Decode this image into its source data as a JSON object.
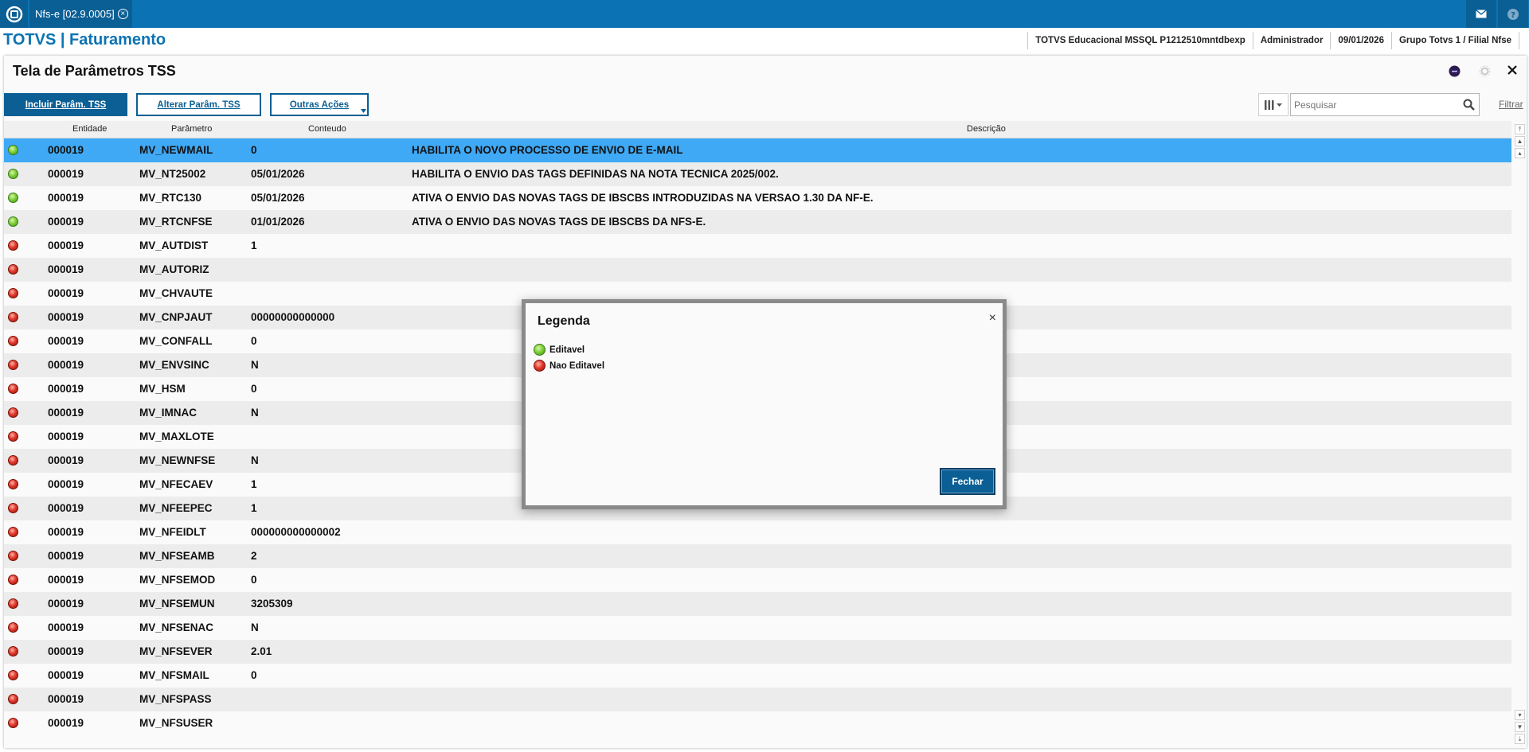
{
  "topbar": {
    "tab_label": "Nfs-e [02.9.0005]",
    "tab_close": "×"
  },
  "header": {
    "brand": "TOTVS | Faturamento",
    "environment": "TOTVS Educacional MSSQL P1212510mntdbexp",
    "user": "Administrador",
    "date": "09/01/2026",
    "company": "Grupo Totvs 1 / Filial Nfse"
  },
  "page": {
    "title": "Tela de Parâmetros TSS"
  },
  "toolbar": {
    "include_label": "Incluir Parâm. TSS",
    "alter_label": "Alterar Parâm. TSS",
    "other_actions_label": "Outras Ações",
    "search_placeholder": "Pesquisar",
    "filter_label": "Filtrar"
  },
  "grid": {
    "columns": [
      "Entidade",
      "Parâmetro",
      "Conteudo",
      "Descrição"
    ],
    "rows": [
      {
        "status": "green",
        "entidade": "000019",
        "parametro": "MV_NEWMAIL",
        "conteudo": "0",
        "descricao": "HABILITA O NOVO PROCESSO DE ENVIO DE E-MAIL"
      },
      {
        "status": "green",
        "entidade": "000019",
        "parametro": "MV_NT25002",
        "conteudo": "05/01/2026",
        "descricao": "HABILITA O ENVIO DAS TAGS DEFINIDAS NA NOTA TECNICA 2025/002."
      },
      {
        "status": "green",
        "entidade": "000019",
        "parametro": "MV_RTC130",
        "conteudo": "05/01/2026",
        "descricao": "ATIVA O ENVIO DAS NOVAS TAGS DE IBSCBS INTRODUZIDAS NA VERSAO 1.30 DA NF-E."
      },
      {
        "status": "green",
        "entidade": "000019",
        "parametro": "MV_RTCNFSE",
        "conteudo": "01/01/2026",
        "descricao": "ATIVA O ENVIO DAS NOVAS TAGS DE IBSCBS DA NFS-E."
      },
      {
        "status": "red",
        "entidade": "000019",
        "parametro": "MV_AUTDIST",
        "conteudo": "1",
        "descricao": ""
      },
      {
        "status": "red",
        "entidade": "000019",
        "parametro": "MV_AUTORIZ",
        "conteudo": "",
        "descricao": ""
      },
      {
        "status": "red",
        "entidade": "000019",
        "parametro": "MV_CHVAUTE",
        "conteudo": "",
        "descricao": ""
      },
      {
        "status": "red",
        "entidade": "000019",
        "parametro": "MV_CNPJAUT",
        "conteudo": "00000000000000",
        "descricao": ""
      },
      {
        "status": "red",
        "entidade": "000019",
        "parametro": "MV_CONFALL",
        "conteudo": "0",
        "descricao": ""
      },
      {
        "status": "red",
        "entidade": "000019",
        "parametro": "MV_ENVSINC",
        "conteudo": "N",
        "descricao": ""
      },
      {
        "status": "red",
        "entidade": "000019",
        "parametro": "MV_HSM",
        "conteudo": "0",
        "descricao": ""
      },
      {
        "status": "red",
        "entidade": "000019",
        "parametro": "MV_IMNAC",
        "conteudo": "N",
        "descricao": ""
      },
      {
        "status": "red",
        "entidade": "000019",
        "parametro": "MV_MAXLOTE",
        "conteudo": "",
        "descricao": ""
      },
      {
        "status": "red",
        "entidade": "000019",
        "parametro": "MV_NEWNFSE",
        "conteudo": "N",
        "descricao": ""
      },
      {
        "status": "red",
        "entidade": "000019",
        "parametro": "MV_NFECAEV",
        "conteudo": "1",
        "descricao": ""
      },
      {
        "status": "red",
        "entidade": "000019",
        "parametro": "MV_NFEEPEC",
        "conteudo": "1",
        "descricao": ""
      },
      {
        "status": "red",
        "entidade": "000019",
        "parametro": "MV_NFEIDLT",
        "conteudo": "000000000000002",
        "descricao": ""
      },
      {
        "status": "red",
        "entidade": "000019",
        "parametro": "MV_NFSEAMB",
        "conteudo": "2",
        "descricao": ""
      },
      {
        "status": "red",
        "entidade": "000019",
        "parametro": "MV_NFSEMOD",
        "conteudo": "0",
        "descricao": ""
      },
      {
        "status": "red",
        "entidade": "000019",
        "parametro": "MV_NFSEMUN",
        "conteudo": "3205309",
        "descricao": ""
      },
      {
        "status": "red",
        "entidade": "000019",
        "parametro": "MV_NFSENAC",
        "conteudo": "N",
        "descricao": ""
      },
      {
        "status": "red",
        "entidade": "000019",
        "parametro": "MV_NFSEVER",
        "conteudo": "2.01",
        "descricao": ""
      },
      {
        "status": "red",
        "entidade": "000019",
        "parametro": "MV_NFSMAIL",
        "conteudo": "0",
        "descricao": ""
      },
      {
        "status": "red",
        "entidade": "000019",
        "parametro": "MV_NFSPASS",
        "conteudo": "",
        "descricao": ""
      },
      {
        "status": "red",
        "entidade": "000019",
        "parametro": "MV_NFSUSER",
        "conteudo": "",
        "descricao": ""
      }
    ],
    "selected_index": 0
  },
  "dialog": {
    "title": "Legenda",
    "close": "×",
    "items": [
      {
        "color": "green",
        "label": "Editavel"
      },
      {
        "color": "red",
        "label": "Nao Editavel"
      }
    ],
    "button_label": "Fechar"
  },
  "colors": {
    "brand_blue": "#0b73b3",
    "button_blue": "#0b5f94",
    "selected_row": "#3fa9f5"
  },
  "icons": [
    "totvs-logo-icon",
    "mail-icon",
    "help-icon",
    "status-icon",
    "settings-icon",
    "close-icon",
    "columns-icon",
    "search-icon"
  ]
}
